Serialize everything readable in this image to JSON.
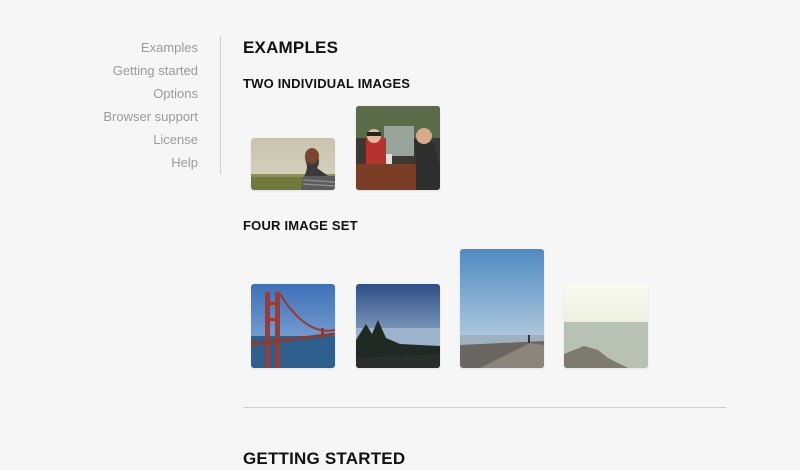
{
  "sidebar": {
    "items": [
      {
        "label": "Examples"
      },
      {
        "label": "Getting started"
      },
      {
        "label": "Options"
      },
      {
        "label": "Browser support"
      },
      {
        "label": "License"
      },
      {
        "label": "Help"
      }
    ]
  },
  "main": {
    "heading": "EXAMPLES",
    "sections": [
      {
        "title": "TWO INDIVIDUAL IMAGES"
      },
      {
        "title": "FOUR IMAGE SET"
      }
    ]
  },
  "next_section": {
    "heading": "GETTING STARTED"
  }
}
